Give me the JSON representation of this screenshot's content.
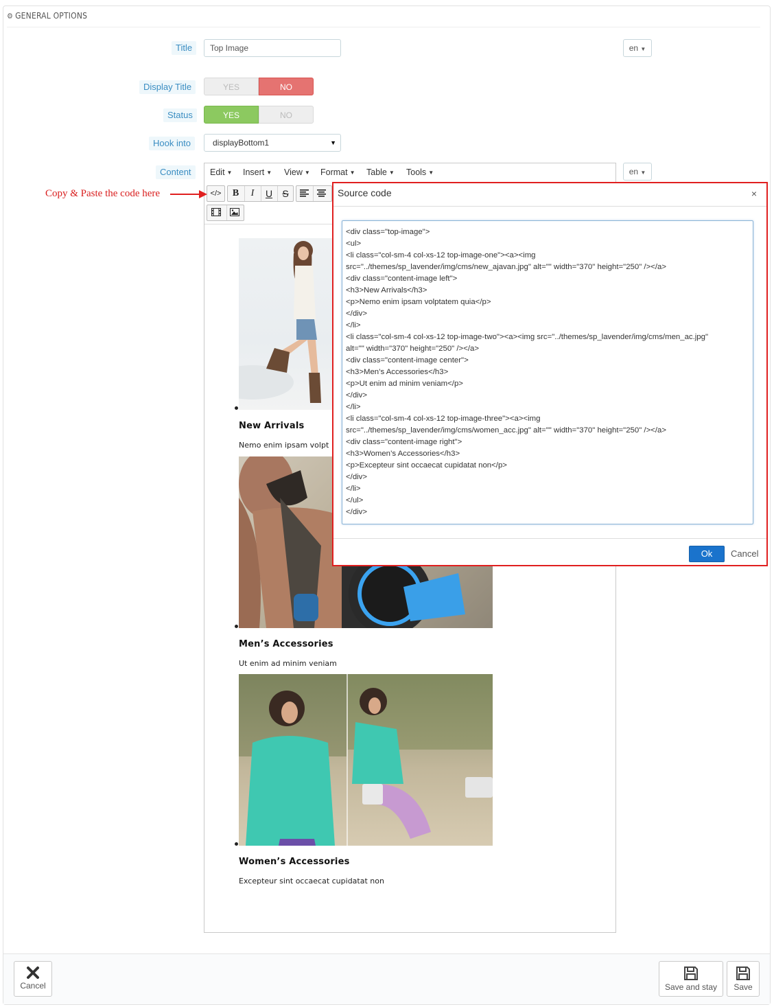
{
  "panel": {
    "heading": "GENERAL OPTIONS"
  },
  "form": {
    "title": {
      "label": "Title",
      "value": "Top Image",
      "lang": "en"
    },
    "display_title": {
      "label": "Display Title",
      "yes": "YES",
      "no": "NO",
      "selected": "NO"
    },
    "status": {
      "label": "Status",
      "yes": "YES",
      "no": "NO",
      "selected": "YES"
    },
    "hook": {
      "label": "Hook into",
      "value": "displayBottom1"
    },
    "content": {
      "label": "Content",
      "lang": "en"
    }
  },
  "editor": {
    "menu": [
      "Edit",
      "Insert",
      "View",
      "Format",
      "Table",
      "Tools"
    ],
    "items": [
      {
        "heading": "New Arrivals",
        "text": "Nemo enim ipsam volptatem quia"
      },
      {
        "heading": "Men’s Accessories",
        "text": "Ut enim ad minim veniam"
      },
      {
        "heading": "Women’s Accessories",
        "text": "Excepteur sint occaecat cupidatat non"
      }
    ],
    "visible_texts": {
      "item1_partial": "Nemo enim ipsam volpt"
    }
  },
  "annotation": "Copy & Paste the code here",
  "modal": {
    "title": "Source code",
    "close": "×",
    "code": "<div class=\"top-image\">\n<ul>\n<li class=\"col-sm-4 col-xs-12 top-image-one\"><a><img\nsrc=\"../themes/sp_lavender/img/cms/new_ajavan.jpg\" alt=\"\" width=\"370\" height=\"250\" /></a>\n<div class=\"content-image left\">\n<h3>New Arrivals</h3>\n<p>Nemo enim ipsam volptatem quia</p>\n</div>\n</li>\n<li class=\"col-sm-4 col-xs-12 top-image-two\"><a><img src=\"../themes/sp_lavender/img/cms/men_ac.jpg\"\nalt=\"\" width=\"370\" height=\"250\" /></a>\n<div class=\"content-image center\">\n<h3>Men’s Accessories</h3>\n<p>Ut enim ad minim veniam</p>\n</div>\n</li>\n<li class=\"col-sm-4 col-xs-12 top-image-three\"><a><img\nsrc=\"../themes/sp_lavender/img/cms/women_acc.jpg\" alt=\"\" width=\"370\" height=\"250\" /></a>\n<div class=\"content-image right\">\n<h3>Women’s Accessories</h3>\n<p>Excepteur sint occaecat cupidatat non</p>\n</div>\n</li>\n</ul>\n</div>",
    "ok": "Ok",
    "cancel": "Cancel"
  },
  "footer": {
    "cancel": "Cancel",
    "save_and_stay": "Save and stay",
    "save": "Save"
  },
  "colors": {
    "accent": "#1a73cc",
    "annotation_red": "#e01f1f",
    "yes_green": "#8cc960",
    "no_red": "#e57371",
    "label_blue": "#3a8dc2"
  }
}
